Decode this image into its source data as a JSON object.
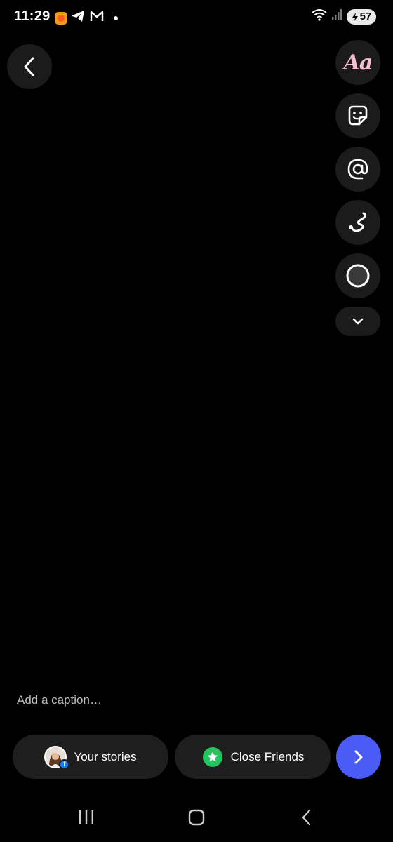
{
  "status_bar": {
    "time": "11:29",
    "battery": "57",
    "left_icons": [
      "app-icon",
      "telegram-icon",
      "gmail-icon",
      "notification-dot"
    ],
    "right_icons": [
      "wifi-icon",
      "signal-icon",
      "battery-icon"
    ]
  },
  "toolbar": {
    "text_tool_label": "Aa",
    "tools": [
      "text-tool",
      "sticker-icon",
      "mention-icon",
      "draw-icon",
      "circle-icon",
      "chevron-down-icon"
    ]
  },
  "caption": {
    "placeholder": "Add a caption…"
  },
  "share": {
    "your_stories_label": "Your stories",
    "close_friends_label": "Close Friends"
  },
  "colors": {
    "accent": "#4a5cf5",
    "close_friends": "#22c55e",
    "button_bg": "#1b1b1b",
    "text_tool": "#f6bcd0"
  }
}
